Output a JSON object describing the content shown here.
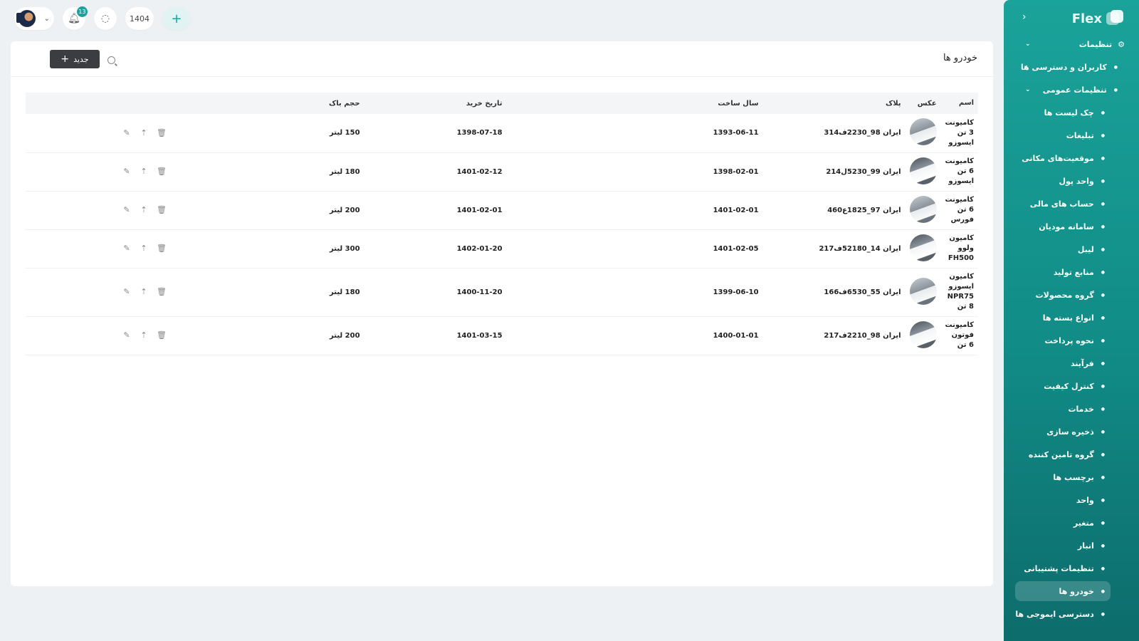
{
  "topbar": {
    "notifications_count": "13",
    "year": "1404",
    "add_label": "+"
  },
  "page": {
    "title": "خودرو ها",
    "new_button_label": "جدید"
  },
  "table": {
    "headers": {
      "name": "اسم",
      "photo": "عکس",
      "plate": "پلاک",
      "build_year": "سال ساخت",
      "purchase_date": "تاریخ خرید",
      "tank_volume": "حجم باک"
    },
    "rows": [
      {
        "name": "کامیونت 3 تن ایسوزو",
        "plate": "ایران 98_2230ف314",
        "build_year": "1393-06-11",
        "purchase_date": "1398-07-18",
        "tank_volume": "150 لیتر"
      },
      {
        "name": "کامیونت 6 تن ایسوزو",
        "plate": "ایران 99_5230ل214",
        "build_year": "1398-02-01",
        "purchase_date": "1401-02-12",
        "tank_volume": "180 لیتر"
      },
      {
        "name": "کامیونت 6 تن فورس",
        "plate": "ایران 97_1825ع460",
        "build_year": "1401-02-01",
        "purchase_date": "1401-02-01",
        "tank_volume": "200 لیتر"
      },
      {
        "name": "کامیون ولوو FH500",
        "plate": "ایران 14_52180ف217",
        "build_year": "1401-02-05",
        "purchase_date": "1402-01-20",
        "tank_volume": "300 لیتر"
      },
      {
        "name": "کامیون ایسوزو NPR75 8 تن",
        "plate": "ایران 55_6530ف166",
        "build_year": "1399-06-10",
        "purchase_date": "1400-11-20",
        "tank_volume": "180 لیتر"
      },
      {
        "name": "کامیونت فوتون 6 تن",
        "plate": "ایران 98_2210ف217",
        "build_year": "1400-01-01",
        "purchase_date": "1401-03-15",
        "tank_volume": "200 لیتر"
      }
    ]
  },
  "sidebar": {
    "brand": "Flex",
    "settings_label": "تنظیمات",
    "users_access_label": "کاربران و دسترسی ها",
    "general_settings_label": "تنظیمات عمومی",
    "items": [
      "چک لیست ها",
      "تبلیغات",
      "موقعیت‌های مکانی",
      "واحد پول",
      "حساب های مالی",
      "سامانه مودیان",
      "لیبل",
      "منابع تولید",
      "گروه محصولات",
      "انواع بسته ها",
      "نحوه پرداخت",
      "فرآیند",
      "کنترل کیفیت",
      "خدمات",
      "ذخیره سازی",
      "گروه تامین کننده",
      "برچسب ها",
      "واحد",
      "متغیر",
      "انبار",
      "تنظیمات پشتیبانی",
      "خودرو ها",
      "دسترسی ایموجی ها"
    ]
  }
}
